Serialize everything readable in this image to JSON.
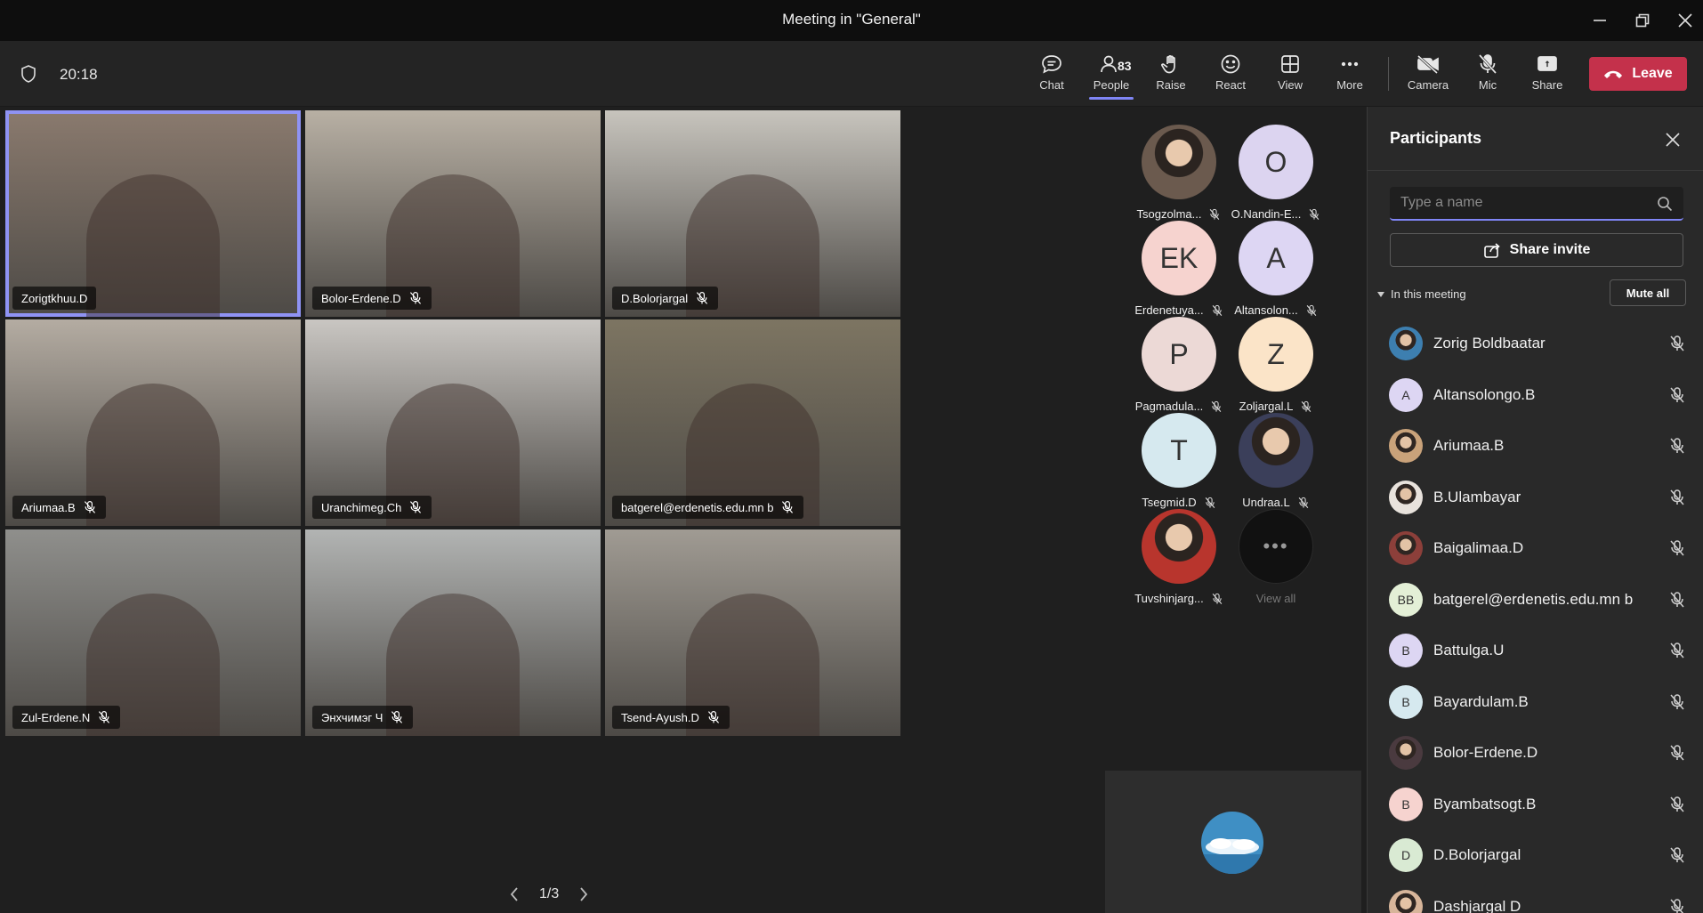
{
  "window": {
    "title": "Meeting in \"General\""
  },
  "toolbar": {
    "timer": "20:18",
    "people_count": "83",
    "buttons": [
      {
        "id": "chat",
        "label": "Chat",
        "icon": "chat-icon"
      },
      {
        "id": "people",
        "label": "People",
        "icon": "people-icon",
        "active": true
      },
      {
        "id": "raise",
        "label": "Raise",
        "icon": "hand-icon"
      },
      {
        "id": "react",
        "label": "React",
        "icon": "smiley-icon"
      },
      {
        "id": "view",
        "label": "View",
        "icon": "grid-icon"
      },
      {
        "id": "more",
        "label": "More",
        "icon": "ellipsis-icon"
      },
      {
        "id": "camera",
        "label": "Camera",
        "icon": "camera-off-icon"
      },
      {
        "id": "mic",
        "label": "Mic",
        "icon": "mic-off-icon"
      },
      {
        "id": "share",
        "label": "Share",
        "icon": "share-tray-icon"
      }
    ],
    "leave_label": "Leave"
  },
  "videos": [
    {
      "name": "Zorigtkhuu.D",
      "muted": false,
      "speaking": true,
      "bg": "#8a7a6e"
    },
    {
      "name": "Bolor-Erdene.D",
      "muted": true,
      "bg": "#b8b0a4"
    },
    {
      "name": "D.Bolorjargal",
      "muted": true,
      "bg": "#c7c4bd"
    },
    {
      "name": "Ariumaa.B",
      "muted": true,
      "bg": "#b4aca2"
    },
    {
      "name": "Uranchimeg.Ch",
      "muted": true,
      "bg": "#c9c6c2"
    },
    {
      "name": "batgerel@erdenetis.edu.mn b",
      "muted": true,
      "bg": "#7d7562"
    },
    {
      "name": "Zul-Erdene.N",
      "muted": true,
      "bg": "#8f8f8c"
    },
    {
      "name": "Энхчимэг Ч",
      "muted": true,
      "bg": "#b2b4b3"
    },
    {
      "name": "Tsend-Ayush.D",
      "muted": true,
      "bg": "#a09b93"
    }
  ],
  "pager": {
    "label": "1/3"
  },
  "gallery": [
    {
      "name": "Tsogzolma...",
      "initials": "",
      "color": "#6b5a4e",
      "photo": true
    },
    {
      "name": "O.Nandin-E...",
      "initials": "O",
      "color": "#dcd4f0"
    },
    {
      "name": "Erdenetuya...",
      "initials": "EK",
      "color": "#f6d3cf"
    },
    {
      "name": "Altansolon...",
      "initials": "A",
      "color": "#ddd6f3"
    },
    {
      "name": "Pagmadula...",
      "initials": "P",
      "color": "#ecd9d6"
    },
    {
      "name": "Zoljargal.L",
      "initials": "Z",
      "color": "#fbe4c8"
    },
    {
      "name": "Tsegmid.D",
      "initials": "T",
      "color": "#d6e9ef"
    },
    {
      "name": "Undraa.L",
      "initials": "",
      "color": "#3b3f5a",
      "photo": true
    },
    {
      "name": "Tuvshinjarg...",
      "initials": "",
      "color": "#b8352d",
      "photo": true
    }
  ],
  "gallery_view_all": "View all",
  "panel": {
    "title": "Participants",
    "search_placeholder": "Type a name",
    "share_invite": "Share invite",
    "section_label": "In this meeting",
    "mute_all": "Mute all",
    "participants": [
      {
        "name": "Zorig Boldbaatar",
        "initials": "",
        "color": "#3d7fb0",
        "photo": true
      },
      {
        "name": "Altansolongo.B",
        "initials": "A",
        "color": "#ddd6f3"
      },
      {
        "name": "Ariumaa.B",
        "initials": "",
        "color": "#c9a27a",
        "photo": true
      },
      {
        "name": "B.Ulambayar",
        "initials": "",
        "color": "#e8e2dc",
        "photo": true
      },
      {
        "name": "Baigalimaa.D",
        "initials": "",
        "color": "#8c3f3a",
        "photo": true
      },
      {
        "name": "batgerel@erdenetis.edu.mn b",
        "initials": "BB",
        "color": "#e3efd6"
      },
      {
        "name": "Battulga.U",
        "initials": "B",
        "color": "#ddd6f3"
      },
      {
        "name": "Bayardulam.B",
        "initials": "B",
        "color": "#d6e9ef"
      },
      {
        "name": "Bolor-Erdene.D",
        "initials": "",
        "color": "#4a3a3f",
        "photo": true
      },
      {
        "name": "Byambatsogt.B",
        "initials": "B",
        "color": "#f6d3cf"
      },
      {
        "name": "D.Bolorjargal",
        "initials": "D",
        "color": "#d9ead3"
      },
      {
        "name": "Dashjargal D",
        "initials": "",
        "color": "#d7b59a",
        "photo": true
      }
    ]
  }
}
